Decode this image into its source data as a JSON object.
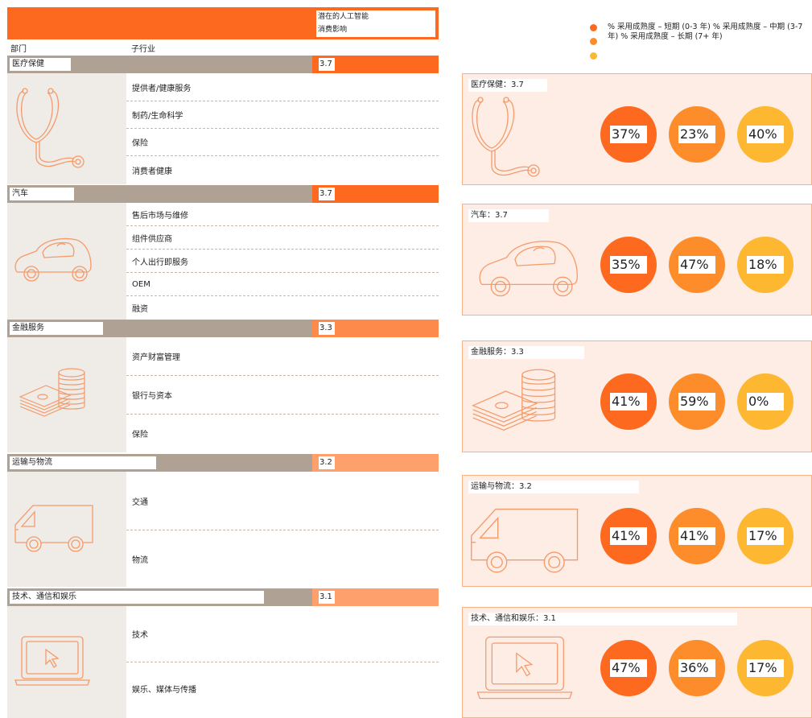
{
  "header": {
    "impact_label_line1": "潜在的人工智能",
    "impact_label_line2": "消费影响",
    "col_dept": "部门",
    "col_sub": "子行业"
  },
  "legend": {
    "text": "% 采用成熟度 – 短期 (0-3 年) % 采用成熟度 – 中期 (3-7 年) % 采用成熟度 – 长期 (7+ 年)",
    "colors": [
      "#fd6a1f",
      "#fd8c2a",
      "#fdb731"
    ]
  },
  "colors": {
    "orange_dark": "#fd6a1f",
    "orange_mid": "#fd8c2a",
    "yellow": "#fdb731",
    "score_3_3": "#fd8a4a",
    "score_light": "#fda06b",
    "gray_bar": "#b0a195",
    "card_bg": "#fdede4"
  },
  "chart_data": {
    "type": "table",
    "sectors": [
      {
        "name": "医疗保健",
        "score": "3.7",
        "icon": "stethoscope-icon",
        "subsectors": [
          "提供者/健康服务",
          "制药/生命科学",
          "保险",
          "消费者健康"
        ],
        "card_title": "医疗保健：3.7",
        "adoption": [
          "37%",
          "23%",
          "40%"
        ]
      },
      {
        "name": "汽车",
        "score": "3.7",
        "icon": "car-icon",
        "subsectors": [
          "售后市场与维修",
          "组件供应商",
          "个人出行即服务",
          "OEM",
          "融资"
        ],
        "card_title": "汽车：3.7",
        "adoption": [
          "35%",
          "47%",
          "18%"
        ]
      },
      {
        "name": "金融服务",
        "score": "3.3",
        "icon": "money-stack-icon",
        "subsectors": [
          "资产财富管理",
          "银行与资本",
          "保险"
        ],
        "card_title": "金融服务：3.3",
        "adoption": [
          "41%",
          "59%",
          "0%"
        ]
      },
      {
        "name": "运输与物流",
        "score": "3.2",
        "icon": "van-icon",
        "subsectors": [
          "交通",
          "物流"
        ],
        "card_title": "运输与物流：3.2",
        "adoption": [
          "41%",
          "41%",
          "17%"
        ]
      },
      {
        "name": "技术、通信和娱乐",
        "score": "3.1",
        "icon": "laptop-cursor-icon",
        "subsectors": [
          "技术",
          "娱乐、媒体与传播"
        ],
        "card_title": "技术、通信和娱乐：3.1",
        "adoption": [
          "47%",
          "36%",
          "17%"
        ]
      }
    ]
  }
}
